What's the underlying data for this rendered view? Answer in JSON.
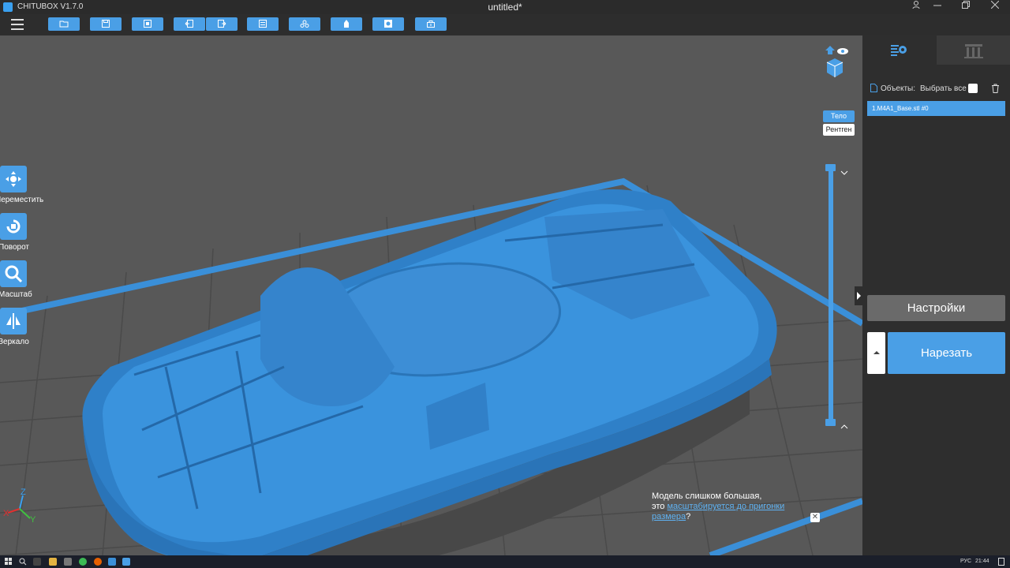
{
  "titlebar": {
    "app_name": "CHITUBOX V1.7.0",
    "document_title": "untitled*"
  },
  "toolbar": {
    "buttons": [
      {
        "name": "open-file",
        "icon": "folder-icon"
      },
      {
        "name": "save-file",
        "icon": "save-icon"
      },
      {
        "name": "import-model",
        "icon": "import-icon"
      },
      {
        "name": "undo",
        "icon": "undo-icon"
      },
      {
        "name": "redo",
        "icon": "redo-icon"
      },
      {
        "name": "layout",
        "icon": "layout-icon"
      },
      {
        "name": "supports",
        "icon": "supports-icon"
      },
      {
        "name": "hollow",
        "icon": "hollow-icon"
      },
      {
        "name": "dig-hole",
        "icon": "hole-icon"
      },
      {
        "name": "add-base",
        "icon": "base-icon"
      }
    ]
  },
  "left_tools": [
    {
      "label": "Переместить",
      "icon": "move-icon"
    },
    {
      "label": "Поворот",
      "icon": "rotate-icon"
    },
    {
      "label": "Масштаб",
      "icon": "scale-icon"
    },
    {
      "label": "Зеркало",
      "icon": "mirror-icon"
    }
  ],
  "view_mode": {
    "solid": "Тело",
    "xray": "Рентген",
    "active": "solid"
  },
  "objects_panel": {
    "header_label": "Объекты:",
    "select_all_label": "Выбрать все",
    "items": [
      "1.M4A1_Base.stl #0"
    ]
  },
  "actions": {
    "settings_label": "Настройки",
    "slice_label": "Нарезать"
  },
  "notice": {
    "text_before": "Модель слишком большая,",
    "text_line2_prefix": "это ",
    "link_text": "масштабируется до пригонки размера",
    "text_after": "?"
  },
  "axes": {
    "x": "X",
    "y": "Y",
    "z": "Z"
  },
  "taskbar": {
    "lang": "РУС",
    "time": "21:44"
  },
  "colors": {
    "accent": "#4a9fe6",
    "model": "#3a8fd8",
    "background": "#585858",
    "panel": "#2e2e2e"
  }
}
